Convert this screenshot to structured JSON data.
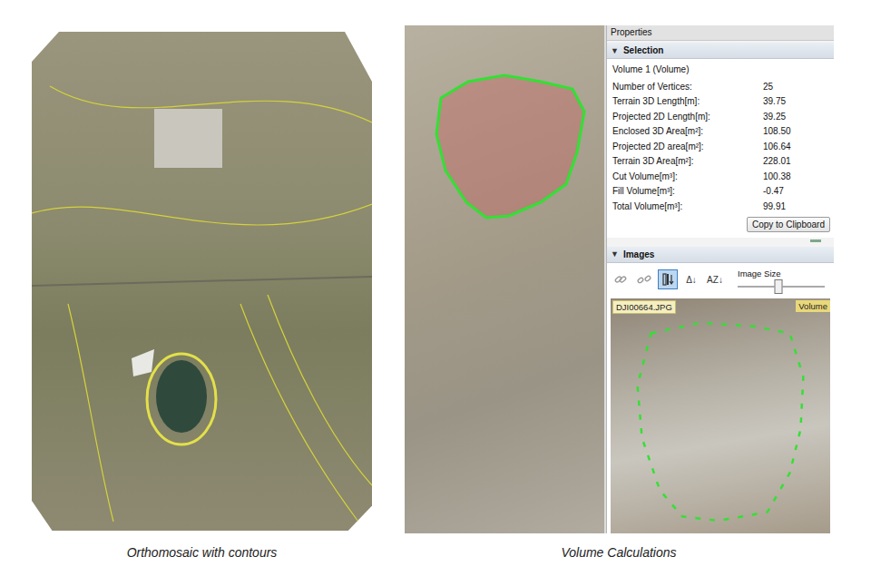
{
  "left_panel": {
    "caption": "Orthomosaic with contours"
  },
  "right_panel": {
    "caption": "Volume Calculations",
    "properties": {
      "title": "Properties",
      "selection": {
        "toggle": "▼",
        "header": "Selection",
        "expanded": true,
        "object": "Volume 1 (Volume)",
        "rows": [
          {
            "label": "Number of Vertices:",
            "value": "25"
          },
          {
            "label": "Terrain 3D Length[m]:",
            "value": "39.75"
          },
          {
            "label": "Projected 2D Length[m]:",
            "value": "39.25"
          },
          {
            "label": "Enclosed 3D Area[m²]:",
            "value": "108.50"
          },
          {
            "label": "Projected 2D area[m²]:",
            "value": "106.64"
          },
          {
            "label": "Terrain 3D Area[m²]:",
            "value": "228.01"
          },
          {
            "label": "Cut Volume[m³]:",
            "value": "100.38"
          },
          {
            "label": "Fill Volume[m³]:",
            "value": "-0.47"
          },
          {
            "label": "Total Volume[m³]:",
            "value": "99.91"
          }
        ],
        "button": "Copy to Clipboard"
      },
      "images": {
        "toggle": "▼",
        "header": "Images",
        "expanded": true,
        "toolbar": [
          {
            "kind": "link",
            "selected": false,
            "disabled": true
          },
          {
            "kind": "unlink",
            "selected": false,
            "disabled": true
          },
          {
            "kind": "order",
            "selected": true,
            "disabled": false
          },
          {
            "kind": "glyph",
            "text": "Δ↓",
            "selected": false,
            "disabled": false
          },
          {
            "kind": "glyph",
            "text": "AZ↓",
            "selected": false,
            "disabled": false
          }
        ],
        "size_label": "Image Size",
        "size_level": 0.47,
        "image": {
          "filename": "DJI00664.JPG",
          "tag": "Volume"
        }
      }
    }
  }
}
